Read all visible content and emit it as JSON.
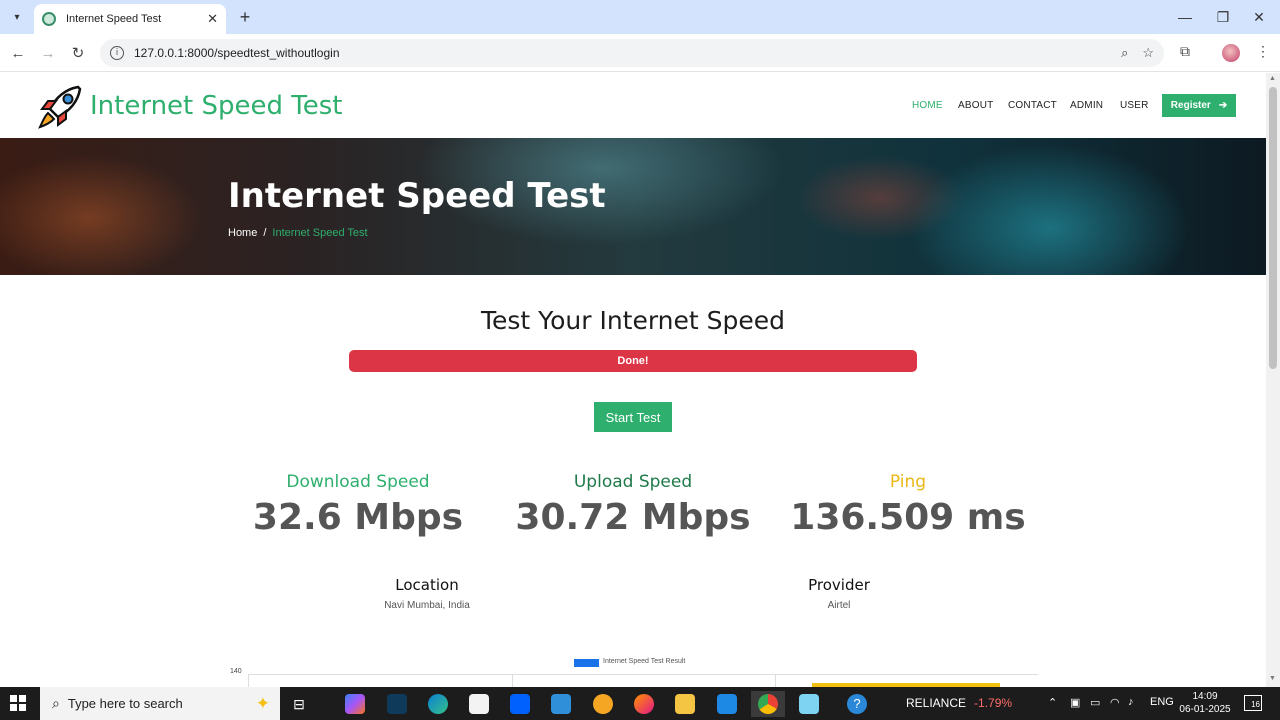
{
  "browser": {
    "tab_title": "Internet Speed Test",
    "url": "127.0.0.1:8000/speedtest_withoutlogin"
  },
  "site": {
    "brand": "Internet Speed Test",
    "nav": [
      "HOME",
      "ABOUT",
      "CONTACT",
      "ADMIN",
      "USER"
    ],
    "register_label": "Register"
  },
  "hero": {
    "title": "Internet Speed Test",
    "breadcrumb_home": "Home",
    "breadcrumb_sep": "/",
    "breadcrumb_current": "Internet Speed Test"
  },
  "main": {
    "title": "Test Your Internet Speed",
    "progress_text": "Done!",
    "progress_fraction": 1.0,
    "start_button": "Start Test"
  },
  "metrics": {
    "download_label": "Download Speed",
    "download_value": "32.6 Mbps",
    "upload_label": "Upload Speed",
    "upload_value": "30.72 Mbps",
    "ping_label": "Ping",
    "ping_value": "136.509 ms"
  },
  "info": {
    "location_label": "Location",
    "location_value": "Navi Mumbai, India",
    "provider_label": "Provider",
    "provider_value": "Airtel"
  },
  "chart": {
    "legend": "Internet Speed Test Result",
    "y_top_tick": "140"
  },
  "taskbar": {
    "search_placeholder": "Type here to search",
    "stock_name": "RELIANCE",
    "stock_change": "-1.79%",
    "lang": "ENG",
    "time": "14:09",
    "date": "06-01-2025",
    "notifications": "16"
  },
  "colors": {
    "brand_green": "#2eaf6d",
    "progress_red": "#dc3545",
    "ping_yellow": "#e9b817",
    "upload_dark_green": "#1f7a4a"
  }
}
